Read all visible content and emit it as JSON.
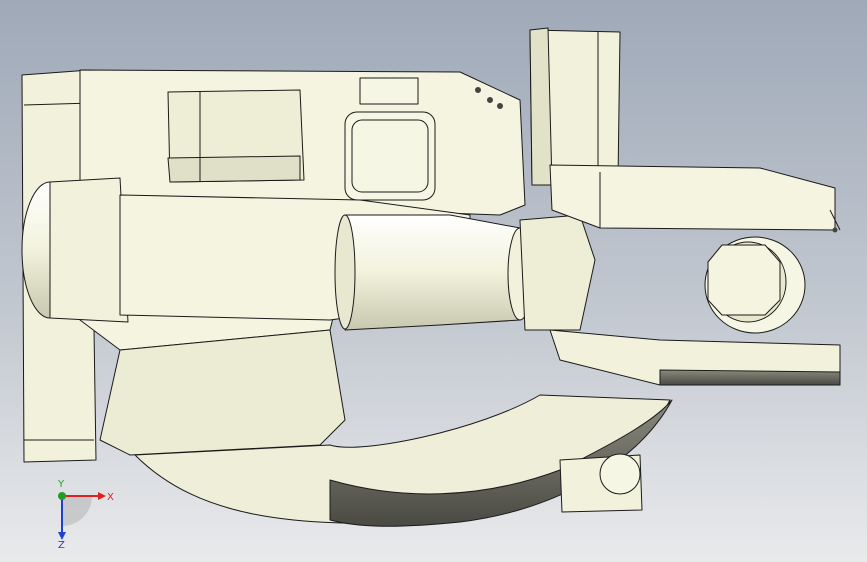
{
  "viewport": {
    "background_top": "#9fa9b8",
    "background_bottom": "#e9eaec"
  },
  "model": {
    "part_color": "#f2f2dc",
    "shade_color": "#d8d8c2",
    "dark_color": "#6b6b62",
    "edge_color": "#1a1a1a"
  },
  "triad": {
    "x_label": "X",
    "y_label": "Y",
    "z_label": "Z",
    "x_color": "#e02020",
    "y_color": "#20a020",
    "z_color": "#2040d0"
  }
}
